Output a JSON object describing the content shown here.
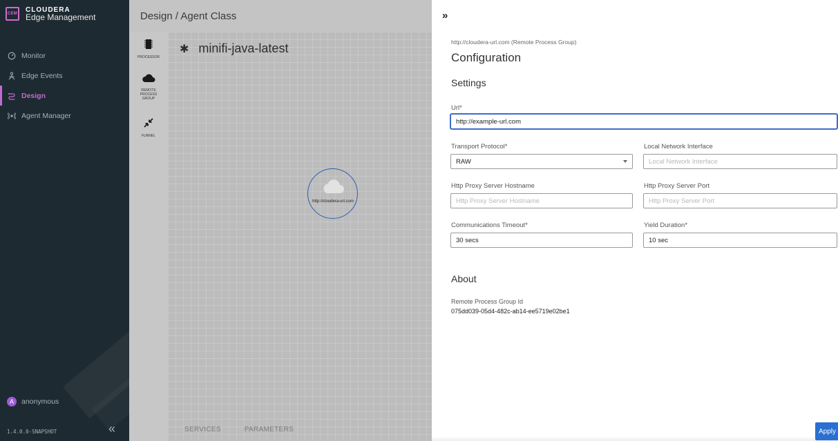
{
  "brand": {
    "logo_text": "CEM",
    "name": "CLOUDERA",
    "product": "Edge Management"
  },
  "nav": {
    "items": [
      {
        "label": "Monitor",
        "icon": "gauge-icon"
      },
      {
        "label": "Edge Events",
        "icon": "events-icon"
      },
      {
        "label": "Design",
        "icon": "design-icon",
        "active": true
      },
      {
        "label": "Agent Manager",
        "icon": "agent-manager-icon"
      }
    ]
  },
  "user": {
    "initial": "A",
    "name": "anonymous"
  },
  "version": "1.4.0.0-SNAPSHOT",
  "sidebar_collapse": "«",
  "main": {
    "breadcrumb": "Design / Agent Class",
    "palette": [
      {
        "label": "PROCESSOR",
        "icon": "processor-icon"
      },
      {
        "label": "REMOTE\nPROCESS\nGROUP",
        "icon": "cloud-icon"
      },
      {
        "label": "FUNNEL",
        "icon": "funnel-icon"
      }
    ],
    "flow_star": "✱",
    "flow_name": "minifi-java-latest",
    "node_label": "http://cloudera-url.com",
    "bottom_tabs": [
      "SERVICES",
      "PARAMETERS"
    ]
  },
  "panel": {
    "expand_icon": "»",
    "subtitle": "http://cloudera-url.com (Remote Process Group)",
    "title": "Configuration",
    "settings_heading": "Settings",
    "fields": {
      "url": {
        "label": "Url*",
        "value": "http://example-url.com"
      },
      "transport": {
        "label": "Transport Protocol*",
        "value": "RAW"
      },
      "local_iface": {
        "label": "Local Network Interface",
        "placeholder": "Local Network Interface"
      },
      "proxy_host": {
        "label": "Http Proxy Server Hostname",
        "placeholder": "Http Proxy Server Hostname"
      },
      "proxy_port": {
        "label": "Http Proxy Server Port",
        "placeholder": "Http Proxy Server Port"
      },
      "timeout": {
        "label": "Communications Timeout*",
        "value": "30 secs"
      },
      "yield": {
        "label": "Yield Duration*",
        "value": "10 sec"
      }
    },
    "about_heading": "About",
    "rpg_id_label": "Remote Process Group Id",
    "rpg_id_value": "075dd039-05d4-482c-ab14-ee5719e02be1",
    "apply_label": "Apply"
  },
  "colors": {
    "sidebar_bg": "#1e2a31",
    "accent": "#c06ad2",
    "primary": "#2a6fd1",
    "focus": "#3d6cc9"
  }
}
